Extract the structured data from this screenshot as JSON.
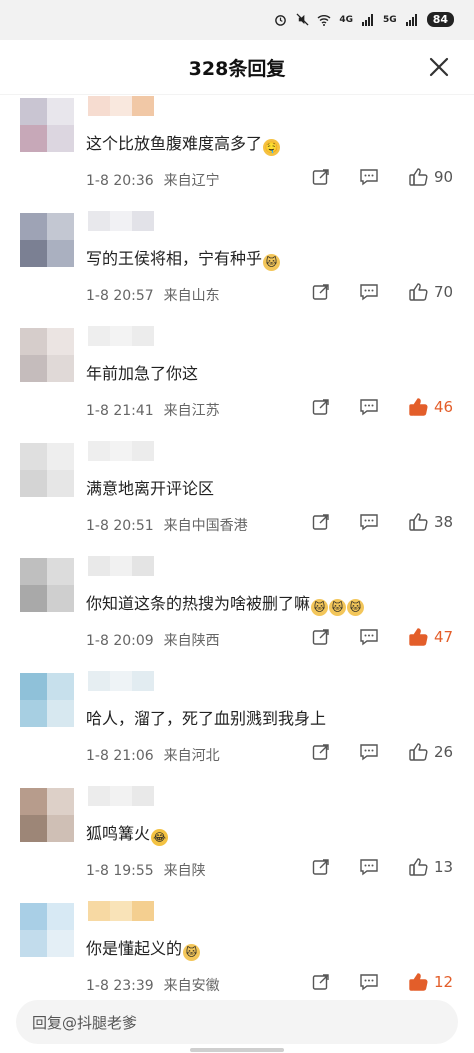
{
  "status": {
    "battery": "84",
    "net1": "4G",
    "net2": "5G"
  },
  "header": {
    "title": "328条回复"
  },
  "comments": [
    {
      "text": "这个比放鱼腹难度高多了",
      "emoji": "🤤",
      "time": "1-8 20:36",
      "location": "来自辽宁",
      "likes": "90",
      "liked": false
    },
    {
      "text": "写的王侯将相，宁有种乎",
      "emoji": "🐱",
      "time": "1-8 20:57",
      "location": "来自山东",
      "likes": "70",
      "liked": false
    },
    {
      "text": "年前加急了你这",
      "emoji": "",
      "time": "1-8 21:41",
      "location": "来自江苏",
      "likes": "46",
      "liked": true
    },
    {
      "text": "满意地离开评论区",
      "emoji": "",
      "time": "1-8 20:51",
      "location": "来自中国香港",
      "likes": "38",
      "liked": false
    },
    {
      "text": "你知道这条的热搜为啥被删了嘛",
      "emoji": "🐱🐱🐱",
      "time": "1-8 20:09",
      "location": "来自陕西",
      "likes": "47",
      "liked": true
    },
    {
      "text": "哈人，溜了，死了血别溅到我身上",
      "emoji": "",
      "time": "1-8 21:06",
      "location": "来自河北",
      "likes": "26",
      "liked": false
    },
    {
      "text": "狐鸣篝火",
      "emoji": "😂",
      "time": "1-8 19:55",
      "location": "来自陕",
      "likes": "13",
      "liked": false
    },
    {
      "text": "你是懂起义的",
      "emoji": "🐱",
      "time": "1-8 23:39",
      "location": "来自安徽",
      "likes": "12",
      "liked": true
    }
  ],
  "reply_bar": {
    "placeholder": "回复@抖腿老爹"
  },
  "colors": {
    "accent": "#e35e2a",
    "text": "#222222",
    "meta": "#666666"
  }
}
